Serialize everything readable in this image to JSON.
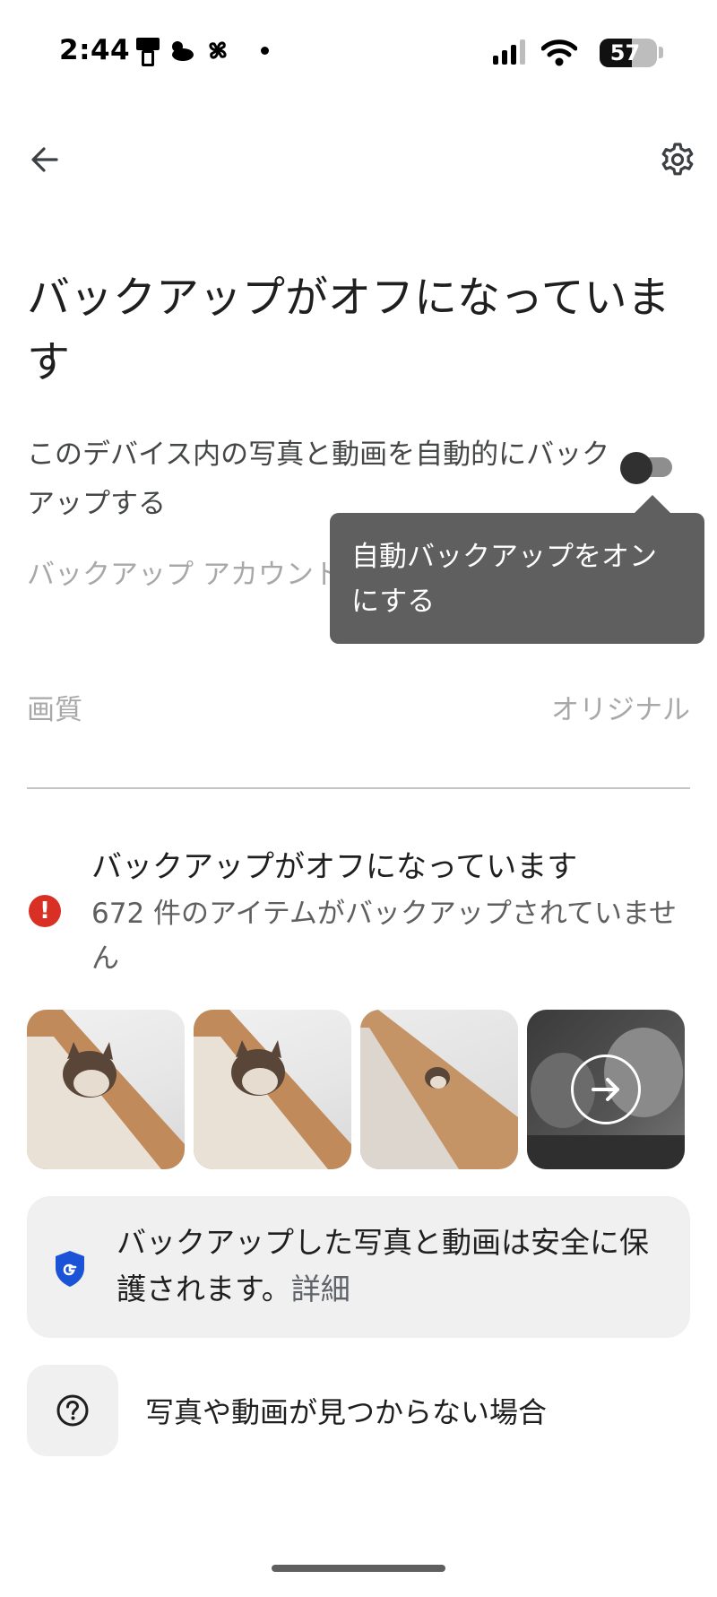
{
  "status_bar": {
    "time": "2:44",
    "battery_level": "57",
    "battery_fraction": 0.57,
    "icons": [
      "phone-icon",
      "cloud-icon",
      "pinwheel-icon",
      "dot-icon",
      "signal-icon",
      "wifi-icon",
      "battery-icon"
    ]
  },
  "app_bar": {
    "back_icon": "arrow-back-icon",
    "settings_icon": "gear-icon"
  },
  "page": {
    "title": "バックアップがオフになっています"
  },
  "settings": {
    "auto_backup_label": "このデバイス内の写真と動画を自動的にバックアップする",
    "auto_backup_enabled": false,
    "backup_account_label": "バックアップ アカウント",
    "quality_label": "画質",
    "quality_value": "オリジナル"
  },
  "tooltip": {
    "text": "自動バックアップをオンにする"
  },
  "warning": {
    "icon": "error-icon",
    "title": "バックアップがオフになっています",
    "subtitle": "672 件のアイテムがバックアップされていません"
  },
  "thumbnails": {
    "more_icon": "arrow-right-icon"
  },
  "info_card": {
    "icon": "google-shield-icon",
    "text": "バックアップした写真と動画は安全に保護されます。",
    "link": "詳細"
  },
  "help": {
    "icon": "help-circle-icon",
    "text": "写真や動画が見つからない場合"
  },
  "colors": {
    "error": "#d93025",
    "tooltip_bg": "#5f5f5f",
    "card_bg": "#f0f0f0",
    "shield_blue": "#1a53d6"
  }
}
